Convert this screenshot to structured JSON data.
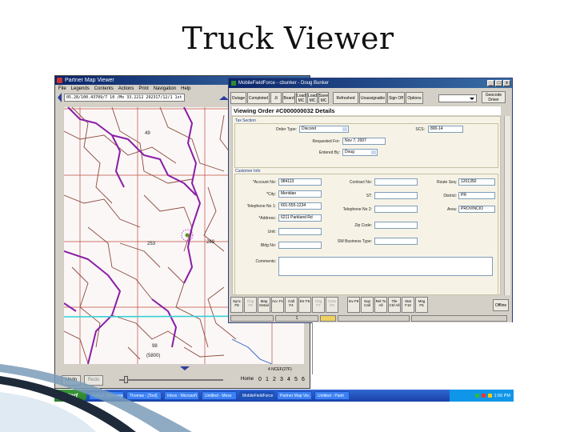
{
  "slide": {
    "title": "Truck Viewer"
  },
  "map_window": {
    "title": "Partner Map Viewer",
    "menu": [
      "File",
      "Legends",
      "Contents",
      "Actions",
      "Print",
      "Navigation",
      "Help"
    ],
    "coords": "05.28/100.43709/7 10 /Mo 33.2212 292317/12/1 1st",
    "labels": [
      "49",
      "253",
      "269",
      "(5800)",
      "98"
    ],
    "bottom": {
      "undo": "Undo",
      "redo": "Redo",
      "home": "Home",
      "pages": [
        "0",
        "1",
        "2",
        "3",
        "4",
        "5",
        "6"
      ],
      "scale": "4 NCEF(27F)"
    }
  },
  "mff_window": {
    "title": "MobileFieldForce - cbunker - Doug Bunker",
    "toolbar": [
      "Outage",
      "Completed",
      "Jt",
      "Board",
      "Load MC",
      "Load MC",
      "Save MC",
      "Refreshed",
      "Unassignable",
      "Sign Off",
      "Options"
    ],
    "geocode": "Geocode Driver",
    "view_header": "Viewing Order #C000000032 Details",
    "sections": {
      "tax": "Tax Section",
      "customer": "Customer Info"
    },
    "fields": {
      "order_type": {
        "label": "Order Type:",
        "value": "Discond"
      },
      "scs": {
        "label": "SCS:",
        "value": "800-14"
      },
      "requested_for": {
        "label": "Requested For:",
        "value": "Nov 7, 2007"
      },
      "entered_by": {
        "label": "Entered By:",
        "value": "Doug"
      },
      "account_no": {
        "label": "*Account No:",
        "value": "984113"
      },
      "city": {
        "label": "*City:",
        "value": "Meridian"
      },
      "telephone_1": {
        "label": "Telephone No 1:",
        "value": "601-555-1234"
      },
      "address": {
        "label": "*Address:",
        "value": "6211 Parkland Rd"
      },
      "unit": {
        "label": "Unit:",
        "value": ""
      },
      "bldg": {
        "label": "Bldg No:",
        "value": ""
      },
      "comments": {
        "label": "Comments:",
        "value": ""
      },
      "contract_no": {
        "label": "Contract No:",
        "value": ""
      },
      "st": {
        "label": "ST:",
        "value": ""
      },
      "telephone_2": {
        "label": "Telephone No 2:",
        "value": ""
      },
      "zip": {
        "label": "Zip Code:",
        "value": ""
      },
      "business_type": {
        "label": "SW Business Type:",
        "value": ""
      },
      "route_seq": {
        "label": "Route Seq:",
        "value": "1201350"
      },
      "district": {
        "label": "District:",
        "value": "PR"
      },
      "area": {
        "label": "Area:",
        "value": "PROVINCIO"
      }
    },
    "fkeys": [
      {
        "label": "Sync F8",
        "disabled": false
      },
      {
        "label": "Chg F9",
        "disabled": true
      },
      {
        "label": "Map Detail",
        "disabled": false
      },
      {
        "label": "Acc F1",
        "disabled": false
      },
      {
        "label": "Call F4",
        "disabled": false
      },
      {
        "label": "Err F5",
        "disabled": false
      },
      {
        "label": "Chg F7",
        "disabled": true
      },
      {
        "label": "Conv F6",
        "disabled": true
      },
      {
        "label": "Inv F9",
        "disabled": false
      },
      {
        "label": "Sup Call",
        "disabled": false
      },
      {
        "label": "Rel To All",
        "disabled": false
      },
      {
        "label": "Tile Ctrl All",
        "disabled": false
      },
      {
        "label": "Stat F10",
        "disabled": false
      },
      {
        "label": "Msg F5",
        "disabled": false
      }
    ],
    "offline": "Offline",
    "status": {
      "count": "1"
    }
  },
  "taskbar": {
    "start": "start",
    "tasks": [
      "Yahoo! Messenger",
      "Thomas - [Tool]",
      "Inbox - Microsoft",
      "Untitled - Mess",
      "MobileFieldForce",
      "Partner Map Vie...",
      "Untitled - Paint"
    ],
    "clock": "1:56 PM"
  },
  "colors": {
    "title_bar": "#0a246a",
    "taskbar": "#245edb",
    "start": "#3c9a3c",
    "route_magenta": "#8a1fa6",
    "road_brown": "#8b4a3c",
    "highway_cyan": "#36d1d6",
    "grid_red": "#c04a3a"
  }
}
